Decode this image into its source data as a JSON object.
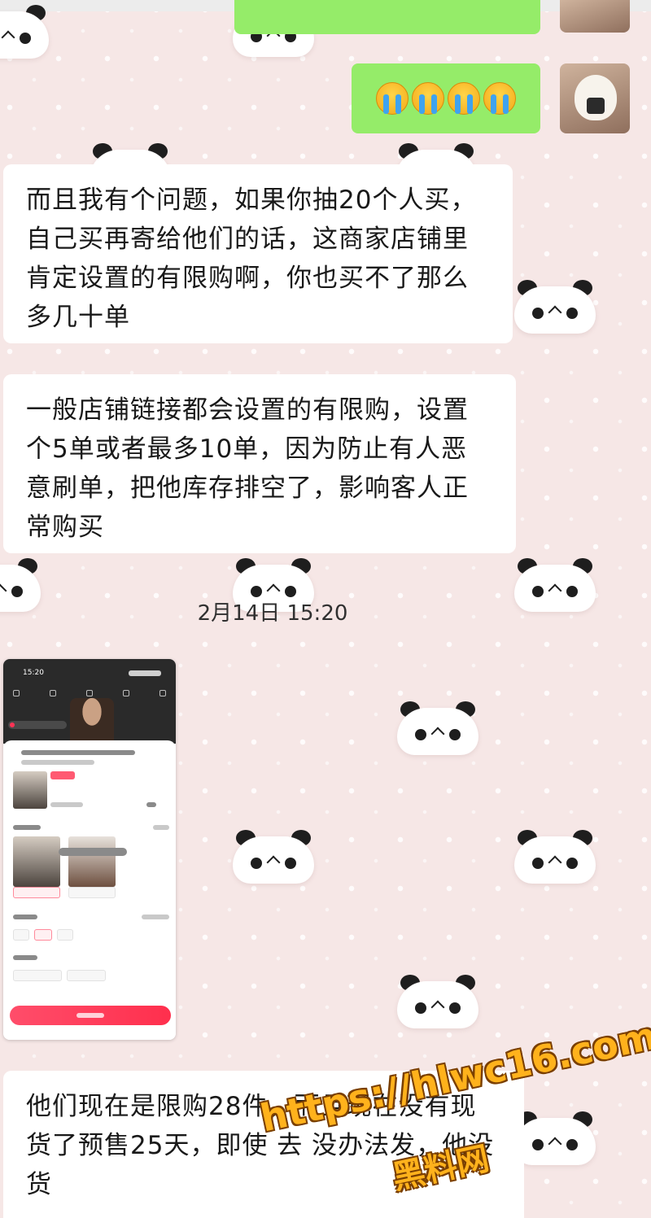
{
  "chat": {
    "sent_message_emojis": [
      "crying-face-emoji",
      "crying-face-emoji",
      "crying-face-emoji",
      "crying-face-emoji"
    ],
    "messages": [
      "而且我有个问题，如果你抽20个人买，自己买再寄给他们的话，这商家店铺里肯定设置的有限购啊，你也买不了那么多几十单",
      "一般店铺链接都会设置的有限购，设置个5单或者最多10单，因为防止有人恶意刷单，把他库存排空了，影响客人正常购买",
      "他们现在是限购28件，而且现在没有现货了预售25天，即使         去                     没办法发，他没货"
    ],
    "timestamp": "2月14日 15:20"
  },
  "shared_screenshot": {
    "status_time": "15:20"
  },
  "watermark": {
    "url": "https://hlwc16.com",
    "site_name": "黑料网"
  },
  "colors": {
    "background": "#f6e7e6",
    "sent_bubble": "#95ec69",
    "received_bubble": "#ffffff",
    "watermark": "#ffb21c"
  }
}
